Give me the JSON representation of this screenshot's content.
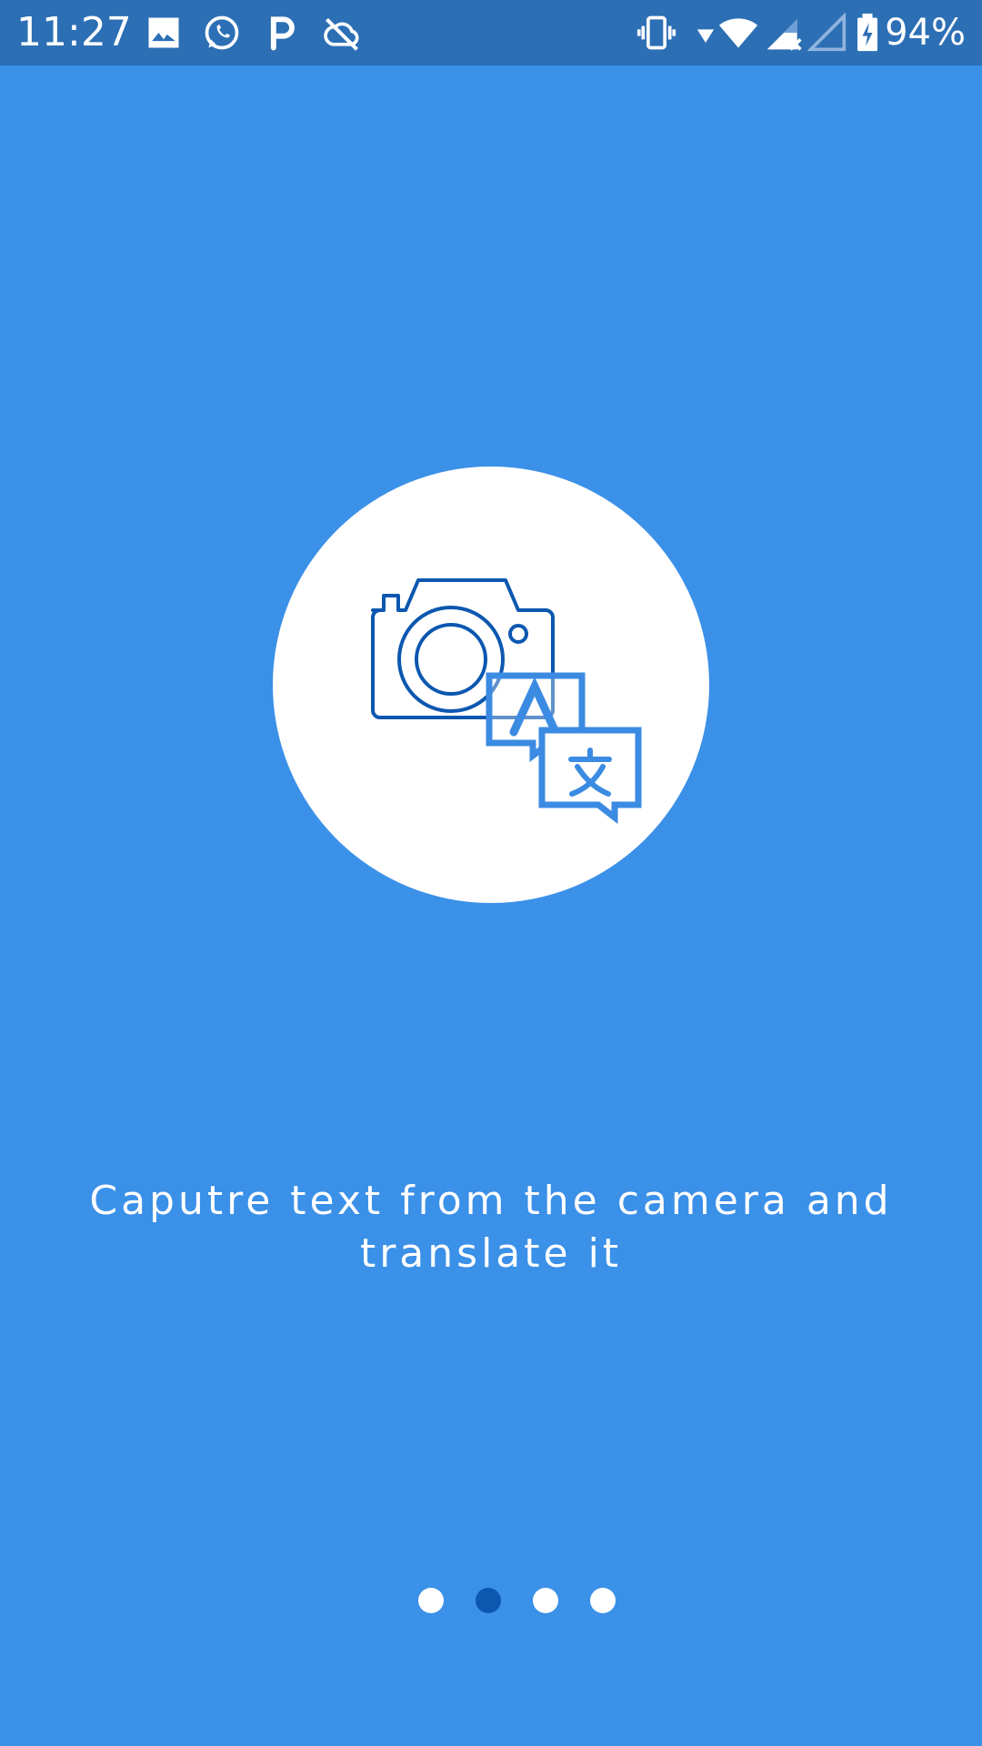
{
  "status_bar": {
    "time": "11:27",
    "battery_percent": "94%",
    "notification_icons": [
      "image-icon",
      "whatsapp-icon",
      "p-icon",
      "cloud-off-icon"
    ],
    "system_icons": [
      "vibrate-icon",
      "wifi-icon",
      "signal-icon",
      "signal-empty-icon",
      "battery-charging-icon"
    ],
    "colors": {
      "background": "#2c6fb5",
      "foreground": "#ffffff"
    }
  },
  "onboarding": {
    "illustration": "camera-translate-icon",
    "caption": "Caputre text from the camera and translate it",
    "pages": 4,
    "current_page": 2
  },
  "colors": {
    "background": "#3b90e8",
    "circle": "#ffffff",
    "icon_dark": "#0c57b0",
    "icon_light": "#3b8be2",
    "dot_inactive": "#ffffff",
    "dot_active": "#0c57b0"
  }
}
